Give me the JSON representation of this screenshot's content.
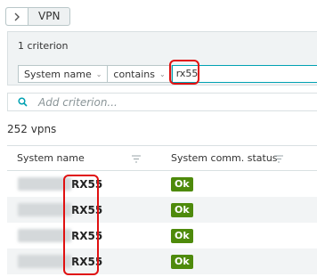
{
  "breadcrumb": {
    "label": "VPN"
  },
  "filter": {
    "criterion_count": "1 criterion",
    "field": "System name",
    "operator": "contains",
    "value": "rx55",
    "add_placeholder": "Add criterion..."
  },
  "results": {
    "count_label": "252 vpns"
  },
  "table": {
    "columns": [
      "System name",
      "System comm. status"
    ],
    "rows": [
      {
        "name": "RX55",
        "status": "Ok"
      },
      {
        "name": "RX55",
        "status": "Ok"
      },
      {
        "name": "RX55",
        "status": "Ok"
      },
      {
        "name": "RX55",
        "status": "Ok"
      }
    ]
  },
  "colors": {
    "accent": "#00a1b2",
    "ok": "#4e8a0b",
    "highlight": "#e01010"
  }
}
